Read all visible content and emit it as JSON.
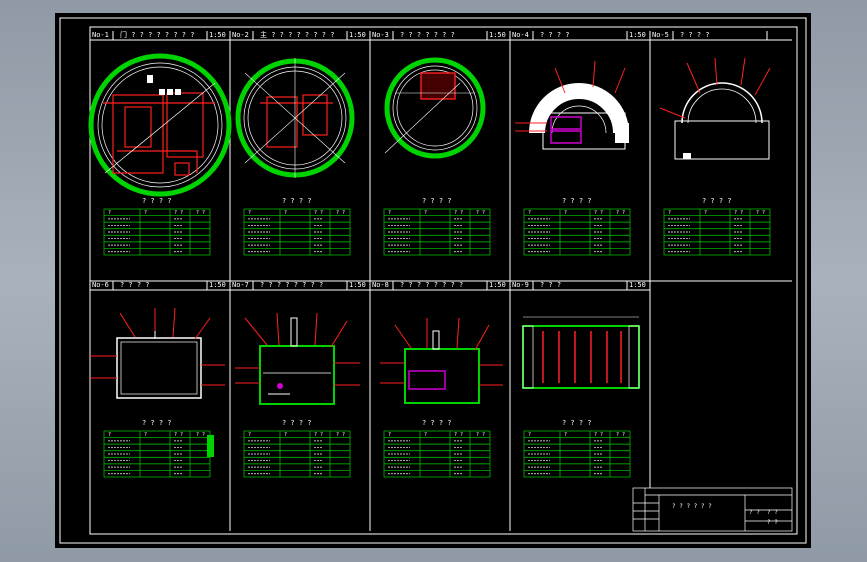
{
  "titleblock": {
    "main_text": "?  ?  ? ? ?  ?",
    "right_texts": [
      "?  ?",
      "?  ?",
      "?  ?"
    ]
  },
  "panels": [
    {
      "no": "No-1",
      "title": "门  ?  ?  ?  ?  ?  ?  ?  ?",
      "scale": "1:50",
      "table_title": "? ? ? ?",
      "headers": [
        "?",
        "?",
        "?  ?",
        "?  ?"
      ]
    },
    {
      "no": "No-2",
      "title": "主  ?  ?  ?  ?  ?  ?  ?  ?",
      "scale": "1:50",
      "table_title": "? ? ? ?",
      "headers": [
        "?",
        "?",
        "?  ?",
        "?  ?"
      ]
    },
    {
      "no": "No-3",
      "title": "?  ?  ?  ?  ?  ?  ?",
      "scale": "1:50",
      "table_title": "? ? ? ?",
      "headers": [
        "?",
        "?",
        "?  ?",
        "?  ?"
      ]
    },
    {
      "no": "No-4",
      "title": "? ? ? ?",
      "scale": "1:50",
      "table_title": "? ? ? ?",
      "headers": [
        "?",
        "?",
        "?  ?",
        "?  ?"
      ]
    },
    {
      "no": "No-5",
      "title": "? ? ? ?",
      "scale": "",
      "table_title": "? ? ? ?",
      "headers": [
        "?",
        "?",
        "?  ?",
        "?  ?"
      ]
    },
    {
      "no": "No-6",
      "title": "? ? ? ?",
      "scale": "1:50",
      "table_title": "? ? ? ?",
      "headers": [
        "?",
        "?",
        "?  ?",
        "?  ?"
      ]
    },
    {
      "no": "No-7",
      "title": "? ? ? ? ? ? ? ?",
      "scale": "1:50",
      "table_title": "? ? ? ?",
      "headers": [
        "?",
        "?",
        "?  ?",
        "?  ?"
      ]
    },
    {
      "no": "No-8",
      "title": "? ? ? ? ? ? ? ?",
      "scale": "1:50",
      "table_title": "? ? ? ?",
      "headers": [
        "?",
        "?",
        "?  ?",
        "?  ?"
      ]
    },
    {
      "no": "No-9",
      "title": "? ? ?",
      "scale": "1:50",
      "table_title": "? ? ? ?",
      "headers": [
        "?",
        "?",
        "?  ?",
        "?  ?"
      ]
    }
  ],
  "colors": {
    "background": "#000000",
    "line": "#ffffff",
    "green": "#00d400",
    "red": "#ff2020",
    "magenta": "#d000d0",
    "frame": "#8f9aa6"
  }
}
